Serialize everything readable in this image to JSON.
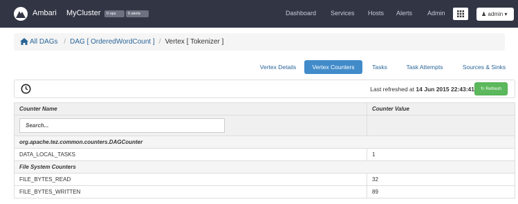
{
  "navbar": {
    "brand": "Ambari",
    "cluster": "MyCluster",
    "ops_badge": "0 ops",
    "alerts_badge": "0 alerts",
    "links": [
      "Dashboard",
      "Services",
      "Hosts",
      "Alerts",
      "Admin"
    ],
    "user": "admin"
  },
  "breadcrumb": {
    "all_dags": "All DAGs",
    "dag": "DAG [ OrderedWordCount ]",
    "vertex": "Vertex [ Tokenizer ]"
  },
  "tabs": [
    "Vertex Details",
    "Vertex Counters",
    "Tasks",
    "Task Attempts",
    "Sources & Sinks"
  ],
  "active_tab": "Vertex Counters",
  "refresh": {
    "label": "Last refreshed at",
    "timestamp": "14 Jun 2015 22:43:41",
    "button": "Refresh"
  },
  "table": {
    "headers": [
      "Counter Name",
      "Counter Value"
    ],
    "search_placeholder": "Search...",
    "groups": [
      {
        "name": "org.apache.tez.common.counters.DAGCounter",
        "rows": [
          {
            "name": "DATA_LOCAL_TASKS",
            "value": "1"
          }
        ]
      },
      {
        "name": "File System Counters",
        "rows": [
          {
            "name": "FILE_BYTES_READ",
            "value": "32"
          },
          {
            "name": "FILE_BYTES_WRITTEN",
            "value": "89"
          }
        ]
      }
    ]
  },
  "colors": {
    "navbar_bg": "#323544",
    "active_tab": "#428bca",
    "refresh_button": "#5cb85c",
    "link": "#2a6496"
  }
}
